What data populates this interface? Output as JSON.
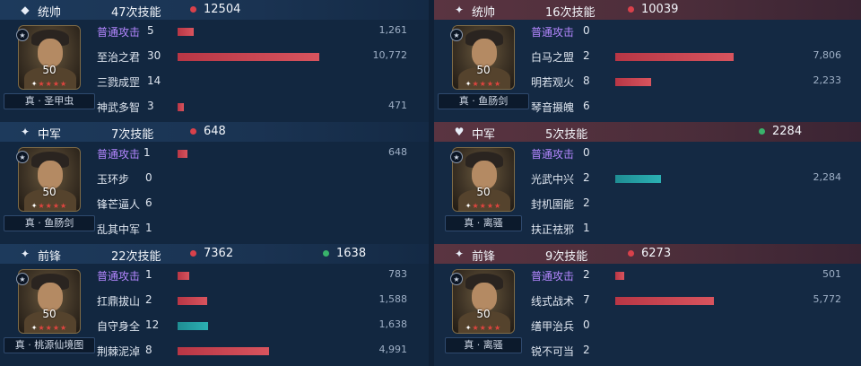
{
  "colors": {
    "left_header": "#1d3a5c",
    "right_header": "#5a3441",
    "damage_bar": "#d8545e",
    "heal_bar": "#2bb0b3",
    "basic_attack_text": "#b487ff",
    "damage_dot": "#d9414b",
    "heal_dot": "#39b36b"
  },
  "panels": [
    {
      "side": "left",
      "role_icon": "commander-flag-icon",
      "role": "统帅",
      "skill_count": "47次技能",
      "damage": "12504",
      "heal": "",
      "level": "50",
      "stars": 5,
      "tactic": "真 · 圣甲虫",
      "skills": [
        {
          "name": "普通攻击",
          "count": "5",
          "value": "1,261",
          "basic": true,
          "type": "red",
          "fill": 0.083
        },
        {
          "name": "至治之君",
          "count": "30",
          "value": "10,772",
          "basic": false,
          "type": "red",
          "fill": 0.719
        },
        {
          "name": "三戮成罡",
          "count": "14",
          "value": "",
          "basic": false,
          "type": "red",
          "fill": 0
        },
        {
          "name": "神武多智",
          "count": "3",
          "value": "471",
          "basic": false,
          "type": "red",
          "fill": 0.03
        }
      ]
    },
    {
      "side": "right",
      "role_icon": "star-icon",
      "role": "统帅",
      "skill_count": "16次技能",
      "damage": "10039",
      "heal": "",
      "level": "50",
      "stars": 5,
      "tactic": "真 · 鱼肠剑",
      "skills": [
        {
          "name": "普通攻击",
          "count": "0",
          "value": "",
          "basic": true,
          "type": "red",
          "fill": 0
        },
        {
          "name": "白马之盟",
          "count": "2",
          "value": "7,806",
          "basic": false,
          "type": "red",
          "fill": 0.6
        },
        {
          "name": "明若观火",
          "count": "8",
          "value": "2,233",
          "basic": false,
          "type": "red",
          "fill": 0.18
        },
        {
          "name": "琴音摄魄",
          "count": "6",
          "value": "",
          "basic": false,
          "type": "red",
          "fill": 0
        }
      ]
    },
    {
      "side": "left",
      "role_icon": "star-icon",
      "role": "中军",
      "skill_count": "7次技能",
      "damage": "648",
      "heal": "",
      "level": "50",
      "stars": 5,
      "tactic": "真 · 鱼肠剑",
      "skills": [
        {
          "name": "普通攻击",
          "count": "1",
          "value": "648",
          "basic": true,
          "type": "red",
          "fill": 0.05
        },
        {
          "name": "玉环步",
          "count": "0",
          "value": "",
          "basic": false,
          "type": "red",
          "fill": 0
        },
        {
          "name": "锋芒逼人",
          "count": "6",
          "value": "",
          "basic": false,
          "type": "red",
          "fill": 0
        },
        {
          "name": "乱其中军",
          "count": "1",
          "value": "",
          "basic": false,
          "type": "red",
          "fill": 0
        }
      ]
    },
    {
      "side": "right",
      "role_icon": "heart-shield-icon",
      "role": "中军",
      "skill_count": "5次技能",
      "damage": "",
      "heal": "2284",
      "level": "50",
      "stars": 5,
      "tactic": "真 · 离骚",
      "skills": [
        {
          "name": "普通攻击",
          "count": "0",
          "value": "",
          "basic": true,
          "type": "red",
          "fill": 0
        },
        {
          "name": "光武中兴",
          "count": "2",
          "value": "2,284",
          "basic": false,
          "type": "teal",
          "fill": 0.23
        },
        {
          "name": "封机圉能",
          "count": "2",
          "value": "",
          "basic": false,
          "type": "red",
          "fill": 0
        },
        {
          "name": "扶正祛邪",
          "count": "1",
          "value": "",
          "basic": false,
          "type": "red",
          "fill": 0
        }
      ]
    },
    {
      "side": "left",
      "role_icon": "star-icon",
      "role": "前锋",
      "skill_count": "22次技能",
      "damage": "7362",
      "heal": "1638",
      "level": "50",
      "stars": 5,
      "tactic": "真 · 桃源仙境图",
      "skills": [
        {
          "name": "普通攻击",
          "count": "1",
          "value": "783",
          "basic": true,
          "type": "red",
          "fill": 0.06
        },
        {
          "name": "扛鼎拔山",
          "count": "2",
          "value": "1,588",
          "basic": false,
          "type": "red",
          "fill": 0.15
        },
        {
          "name": "自守身全",
          "count": "12",
          "value": "1,638",
          "basic": false,
          "type": "teal",
          "fill": 0.155
        },
        {
          "name": "荆棘泥淖",
          "count": "8",
          "value": "4,991",
          "basic": false,
          "type": "red",
          "fill": 0.465
        }
      ]
    },
    {
      "side": "right",
      "role_icon": "star-icon",
      "role": "前锋",
      "skill_count": "9次技能",
      "damage": "6273",
      "heal": "",
      "level": "50",
      "stars": 5,
      "tactic": "真 · 离骚",
      "skills": [
        {
          "name": "普通攻击",
          "count": "2",
          "value": "501",
          "basic": true,
          "type": "red",
          "fill": 0.045
        },
        {
          "name": "线式战术",
          "count": "7",
          "value": "5,772",
          "basic": false,
          "type": "red",
          "fill": 0.5
        },
        {
          "name": "缮甲治兵",
          "count": "0",
          "value": "",
          "basic": false,
          "type": "red",
          "fill": 0
        },
        {
          "name": "锐不可当",
          "count": "2",
          "value": "",
          "basic": false,
          "type": "red",
          "fill": 0
        }
      ]
    }
  ]
}
